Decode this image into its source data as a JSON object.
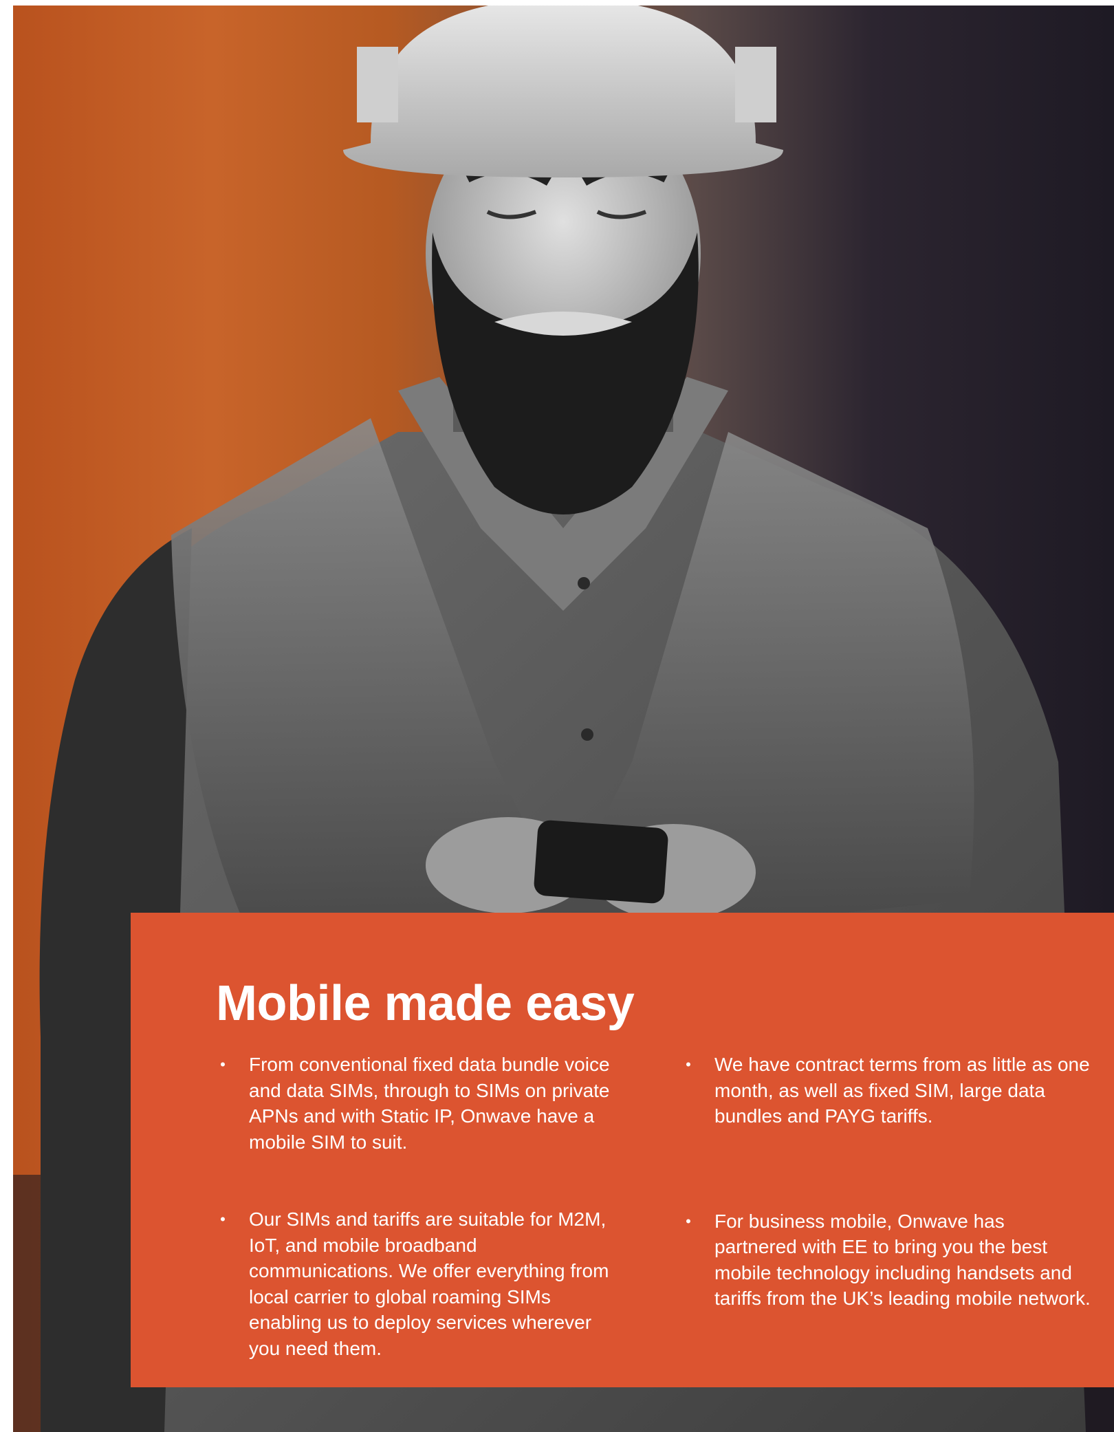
{
  "colors": {
    "panel": "#dc5430",
    "text": "#ffffff",
    "backdrop_orange": "#c8642a",
    "backdrop_dark": "#1e1a24"
  },
  "photo": {
    "description_icon": "worker-with-phone-photo"
  },
  "panel": {
    "title": "Mobile made easy",
    "bullet_glyph": "•",
    "left_items": [
      "From conventional fixed data bundle voice and data SIMs, through to SIMs on private APNs and with Static IP, Onwave have a mobile SIM to suit.",
      "Our SIMs and tariffs are suitable for M2M, IoT, and mobile broadband communications. We offer everything from local carrier to global roaming SIMs enabling us to deploy services wherever you need them."
    ],
    "right_items": [
      "We have contract terms from as little as one month, as well as fixed SIM, large data bundles and PAYG tariffs.",
      "For business mobile, Onwave has partnered with EE to bring you the best mobile technology including handsets and tariffs from the UK’s leading mobile network."
    ]
  }
}
